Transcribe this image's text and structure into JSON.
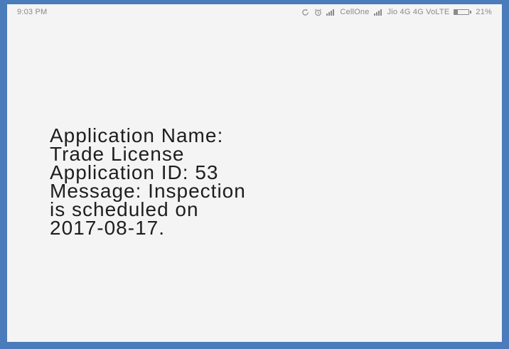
{
  "status_bar": {
    "time": "9:03 PM",
    "carrier_1": "CellOne",
    "carrier_2": "Jio 4G 4G VoLTE",
    "battery_percent": "21%",
    "battery_level": 0.21,
    "icons": [
      "sync-icon",
      "alarm-icon",
      "signal-icon",
      "signal-icon",
      "battery-icon"
    ]
  },
  "notification": {
    "lines": [
      "Application Name:",
      "Trade License",
      "Application ID: 53",
      "Message: Inspection",
      "is scheduled on",
      "2017-08-17."
    ]
  },
  "colors": {
    "frame_border": "#4a7bbb",
    "background": "#f4f4f4",
    "text": "#1e1e1e",
    "status_text": "#8a8a8a"
  }
}
